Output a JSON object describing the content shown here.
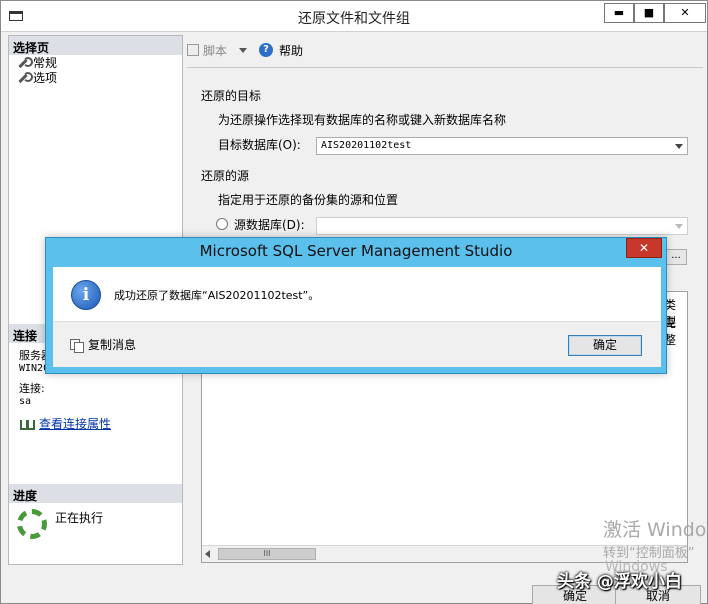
{
  "window": {
    "title": "还原文件和文件组",
    "min_glyph": "▬",
    "max_glyph": "■",
    "close_glyph": "✕"
  },
  "left_pane": {
    "select_page_header": "选择页",
    "pages": [
      "常规",
      "选项"
    ],
    "connection_header": "连接",
    "server_label": "服务器",
    "server_value": "WIN20",
    "connection_label": "连接:",
    "connection_value": "sa",
    "view_props_link": "查看连接属性",
    "progress_header": "进度",
    "progress_status": "正在执行"
  },
  "toolbar": {
    "script_label": "脚本",
    "help_label": "帮助"
  },
  "form": {
    "restore_target_header": "还原的目标",
    "target_instruction": "为还原操作选择现有数据库的名称或键入新数据库名称",
    "target_db_label": "目标数据库(O):",
    "target_db_value": "AIS20201102test",
    "restore_source_header": "还原的源",
    "source_instruction": "指定用于还原的备份集的源和位置",
    "source_db_label": "源数据库(D):",
    "source_db_value": "",
    "ellipsis": "..."
  },
  "grid": {
    "col_type_partial": "类型",
    "col_full_partial": "完整",
    "scroll_thumb": "III"
  },
  "footer": {
    "ok_label": "确定",
    "cancel_label": "取消"
  },
  "dialog": {
    "title": "Microsoft SQL Server Management Studio",
    "close_glyph": "✕",
    "message": "成功还原了数据库“AIS20201102test”。",
    "copy_message_label": "复制消息",
    "ok_label": "确定",
    "info_glyph": "i"
  },
  "watermark": {
    "line1": "激活 Windo",
    "line2": "转到“控制面板”",
    "line3": "Windows",
    "credit": "头条 @浮欢小白"
  }
}
